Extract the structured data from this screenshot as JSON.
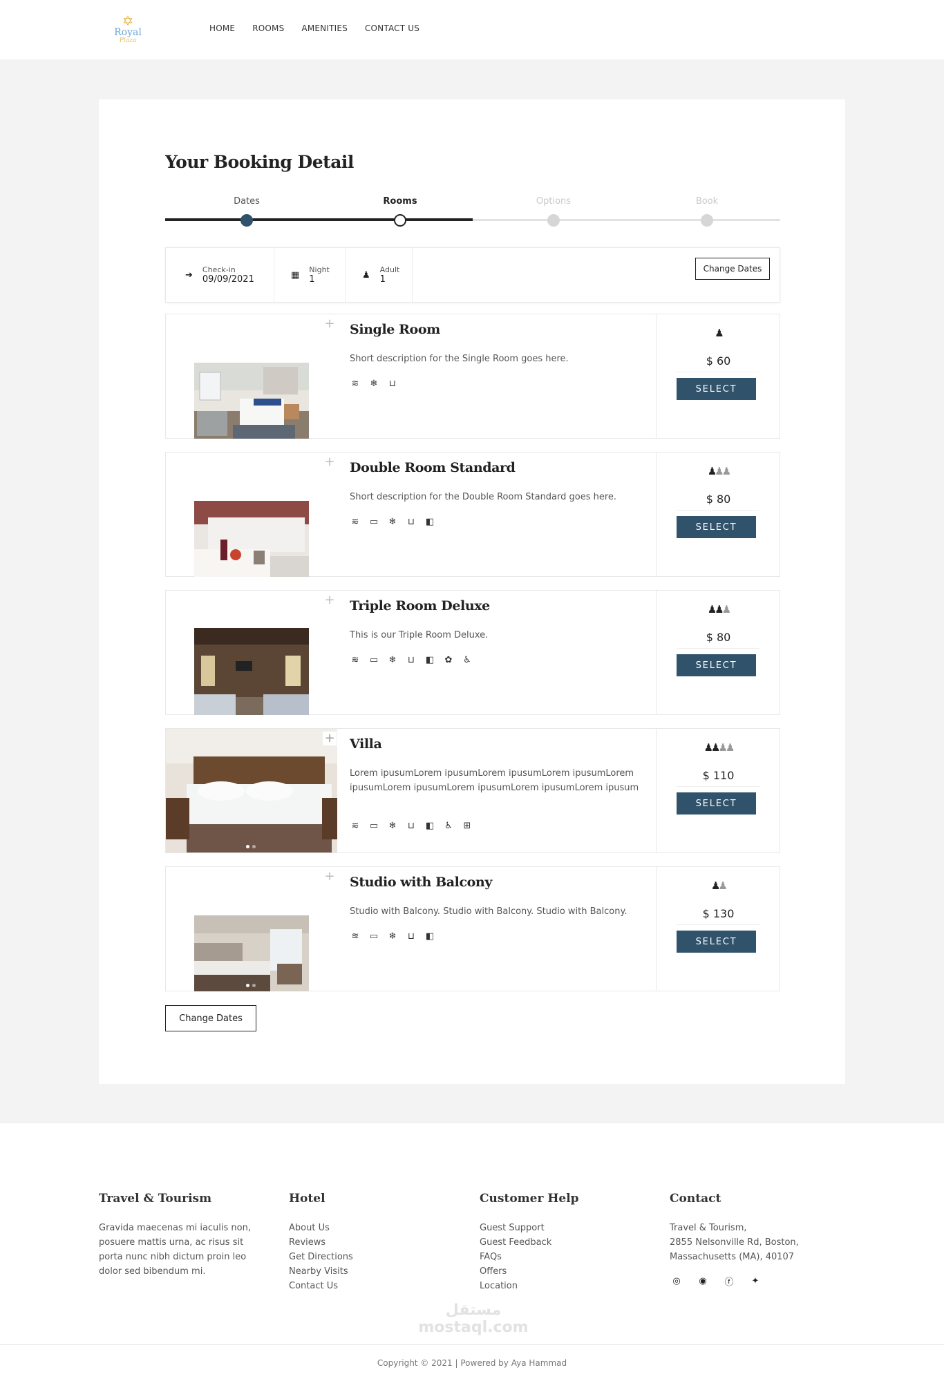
{
  "header": {
    "logo": {
      "word": "Royal",
      "sub": "Plaza"
    },
    "nav": [
      "HOME",
      "ROOMS",
      "AMENITIES",
      "CONTACT US"
    ]
  },
  "booking": {
    "title": "Your Booking Detail",
    "steps": [
      {
        "label": "Dates",
        "state": "done"
      },
      {
        "label": "Rooms",
        "state": "current"
      },
      {
        "label": "Options",
        "state": "upcoming"
      },
      {
        "label": "Book",
        "state": "upcoming"
      }
    ],
    "progress_fraction": 0.5,
    "summary": {
      "checkin_label": "Check-in",
      "checkin_value": "09/09/2021",
      "night_label": "Night",
      "night_value": "1",
      "adult_label": "Adult",
      "adult_value": "1",
      "change_dates": "Change Dates"
    },
    "rooms": [
      {
        "name": "Single Room",
        "description": "Short description for the Single Room goes here.",
        "amenities": [
          "wifi-icon",
          "snowflake-icon",
          "bathtub-icon"
        ],
        "persons": 1,
        "price": "$ 60",
        "select_label": "SELECT"
      },
      {
        "name": "Double Room Standard",
        "description": "Short description for the Double Room Standard goes here.",
        "amenities": [
          "wifi-icon",
          "tv-icon",
          "snowflake-icon",
          "bathtub-icon",
          "minibar-icon"
        ],
        "persons": 2,
        "price": "$ 80",
        "select_label": "SELECT"
      },
      {
        "name": "Triple Room Deluxe",
        "description": "This is our Triple Room Deluxe.",
        "amenities": [
          "wifi-icon",
          "tv-icon",
          "snowflake-icon",
          "bathtub-icon",
          "minibar-icon",
          "paw-icon",
          "wheelchair-icon"
        ],
        "persons": 3,
        "price": "$ 80",
        "select_label": "SELECT"
      },
      {
        "name": "Villa",
        "description": "Lorem ipusumLorem ipusumLorem ipusumLorem ipusumLorem ipusumLorem ipusumLorem ipusumLorem ipusumLorem ipusum",
        "amenities": [
          "wifi-icon",
          "tv-icon",
          "snowflake-icon",
          "bathtub-icon",
          "minibar-icon",
          "wheelchair-icon",
          "gift-icon"
        ],
        "persons": 4,
        "price": "$ 110",
        "select_label": "SELECT"
      },
      {
        "name": "Studio with Balcony",
        "description": "Studio with Balcony. Studio with Balcony. Studio with Balcony.",
        "amenities": [
          "wifi-icon",
          "tv-icon",
          "snowflake-icon",
          "bathtub-icon",
          "minibar-icon"
        ],
        "persons": 2,
        "price": "$ 130",
        "select_label": "SELECT"
      }
    ],
    "bottom_change_dates": "Change Dates"
  },
  "footer": {
    "travel": {
      "heading": "Travel & Tourism",
      "text": "Gravida maecenas mi iaculis non, posuere mattis urna, ac risus sit porta nunc nibh dictum proin leo dolor sed bibendum mi."
    },
    "hotel": {
      "heading": "Hotel",
      "links": [
        "About Us",
        "Reviews",
        "Get Directions",
        "Nearby Visits",
        "Contact Us"
      ]
    },
    "help": {
      "heading": "Customer Help",
      "links": [
        "Guest Support",
        "Guest Feedback",
        "FAQs",
        "Offers",
        "Location"
      ]
    },
    "contact": {
      "heading": "Contact",
      "lines": [
        "Travel & Tourism,",
        "2855 Nelsonville Rd, Boston,",
        "Massachusetts (MA), 40107"
      ],
      "social": [
        "instagram-icon",
        "tripadvisor-icon",
        "facebook-icon",
        "twitter-icon"
      ]
    },
    "watermark": "مستقل mostaql.com",
    "copyright": "Copyright © 2021 | Powered by Aya Hammad"
  },
  "colors": {
    "accent": "#30526b",
    "page_bg": "#f3f3f3",
    "star": "#e8b84a",
    "logo_blue": "#6aa6d6"
  }
}
